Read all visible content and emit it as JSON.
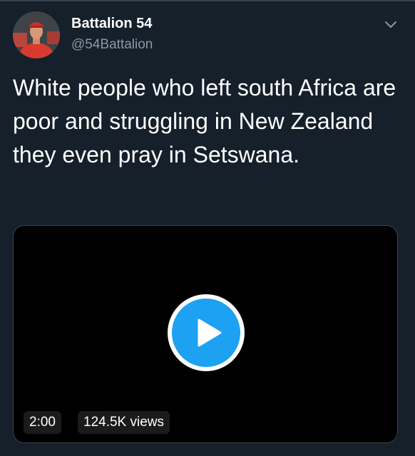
{
  "author": {
    "display_name": "Battalion 54",
    "handle": "@54Battalion",
    "avatar": "profile-photo-man-in-red-shirt"
  },
  "menu": {
    "icon": "chevron-down-icon"
  },
  "tweet": {
    "text": "White people who left south Africa are poor and struggling in New Zealand they even pray in Setswana."
  },
  "video": {
    "duration": "2:00",
    "views": "124.5K views",
    "play_icon": "play-icon"
  },
  "colors": {
    "background": "#15202b",
    "text": "#ffffff",
    "secondary_text": "#8899a6",
    "accent": "#1da1f2",
    "video_bg": "#000000"
  }
}
